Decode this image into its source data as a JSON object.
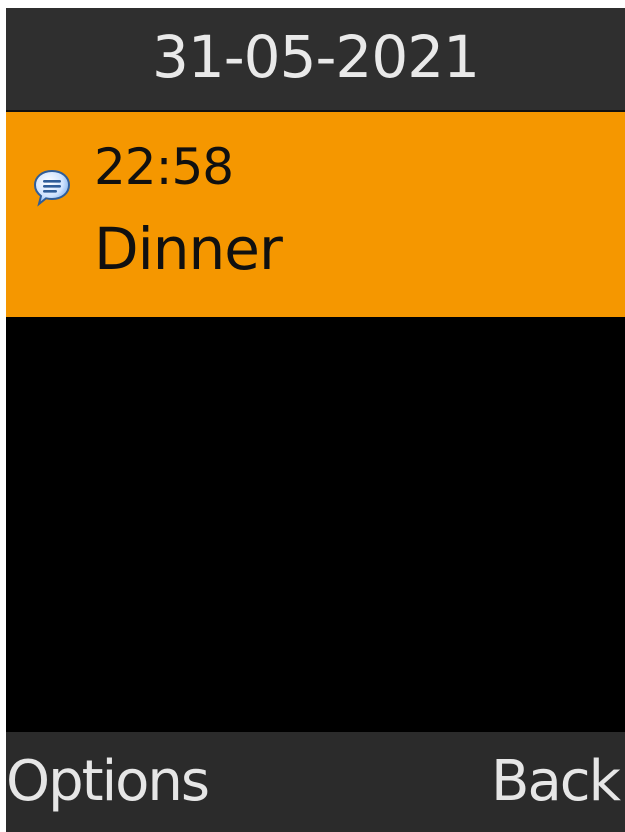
{
  "header": {
    "date": "31-05-2021"
  },
  "items": [
    {
      "icon": "speech-bubble-icon",
      "time": "22:58",
      "title": "Dinner"
    }
  ],
  "softkeys": {
    "left": "Options",
    "right": "Back"
  },
  "colors": {
    "highlight": "#f59700",
    "title_bar": "#2f2f2f",
    "softkey_bar": "#2b2b2b",
    "background": "#000000"
  }
}
